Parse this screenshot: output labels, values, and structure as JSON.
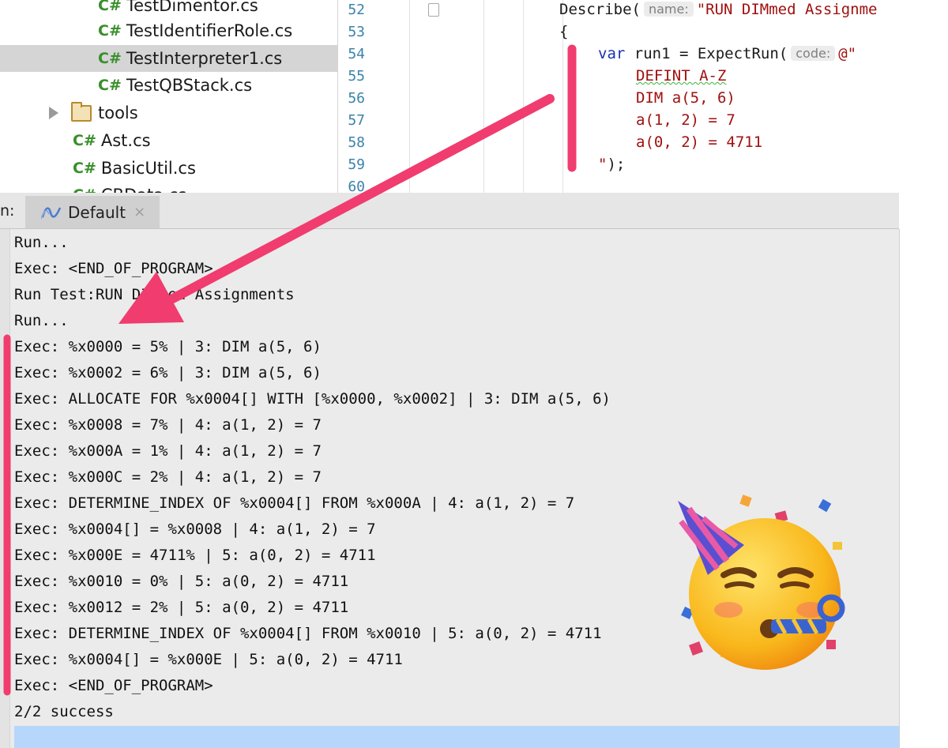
{
  "project_tree": {
    "files": [
      {
        "badge": "C#",
        "name": "TestDimentor.cs"
      },
      {
        "badge": "C#",
        "name": "TestIdentifierRole.cs"
      },
      {
        "badge": "C#",
        "name": "TestInterpreter1.cs",
        "selected": true
      },
      {
        "badge": "C#",
        "name": "TestQBStack.cs"
      }
    ],
    "folder": {
      "name": "tools"
    },
    "root_files": [
      {
        "badge": "C#",
        "name": "Ast.cs"
      },
      {
        "badge": "C#",
        "name": "BasicUtil.cs"
      },
      {
        "badge": "C#",
        "name": "CBData.cs"
      }
    ]
  },
  "editor": {
    "line_numbers": [
      "52",
      "53",
      "54",
      "55",
      "56",
      "57",
      "58",
      "59",
      "60"
    ],
    "lines": {
      "l52_pre": "Describe(",
      "l52_hint": "name:",
      "l52_str": "\"RUN DIMmed Assignme",
      "l53": "{",
      "l54_kw": "var",
      "l54_mid": " run1 = ExpectRun(",
      "l54_hint": "code:",
      "l54_str": "@\"",
      "l55": "DEFINT A-Z",
      "l56": "DIM a(5, 6)",
      "l57": "a(1, 2) = 7",
      "l58": "a(0, 2) = 4711",
      "l59_str": "\"",
      "l59_rest": ");"
    }
  },
  "run_panel": {
    "label": "n:",
    "tab_label": "Default",
    "tab_close": "×"
  },
  "console": {
    "lines": [
      "Run...",
      "Exec: <END_OF_PROGRAM>",
      "Run Test:RUN DIMmed Assignments",
      "Run...",
      "Exec: %x0000 = 5% | 3: DIM a(5, 6)",
      "Exec: %x0002 = 6% | 3: DIM a(5, 6)",
      "Exec: ALLOCATE FOR %x0004[] WITH [%x0000, %x0002] | 3: DIM a(5, 6)",
      "Exec: %x0008 = 7% | 4: a(1, 2) = 7",
      "Exec: %x000A = 1% | 4: a(1, 2) = 7",
      "Exec: %x000C = 2% | 4: a(1, 2) = 7",
      "Exec: DETERMINE_INDEX OF %x0004[] FROM %x000A | 4: a(1, 2) = 7",
      "Exec: %x0004[] = %x0008 | 4: a(1, 2) = 7",
      "Exec: %x000E = 4711% | 5: a(0, 2) = 4711",
      "Exec: %x0010 = 0% | 5: a(0, 2) = 4711",
      "Exec: %x0012 = 2% | 5: a(0, 2) = 4711",
      "Exec: DETERMINE_INDEX OF %x0004[] FROM %x0010 | 5: a(0, 2) = 4711",
      "Exec: %x0004[] = %x000E | 5: a(0, 2) = 4711",
      "Exec: <END_OF_PROGRAM>",
      "2/2 success"
    ]
  },
  "colors": {
    "annotation": "#f03c6e",
    "csharp_badge": "#3a8f2c",
    "selection": "#b6d7fb"
  }
}
